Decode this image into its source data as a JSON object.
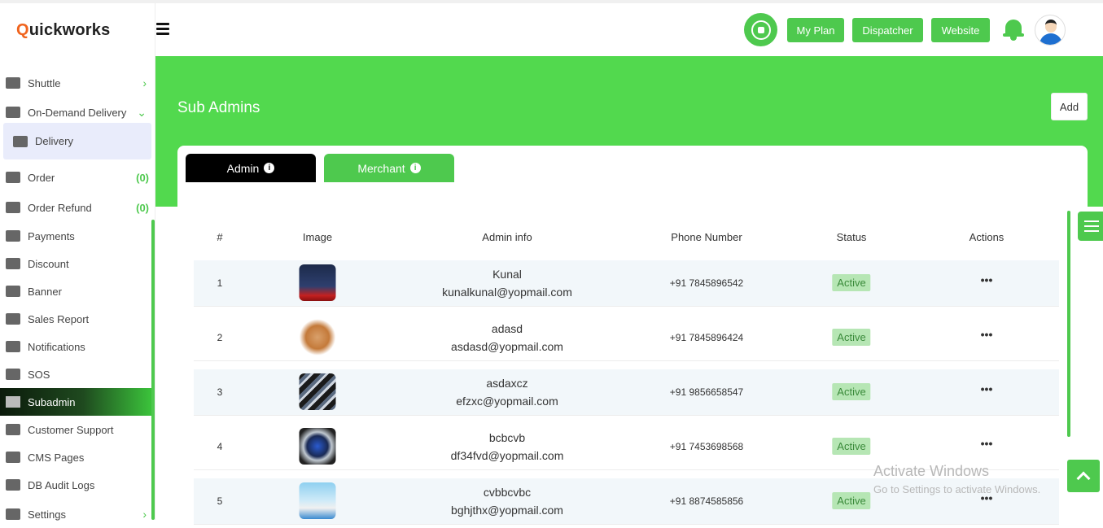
{
  "brand": {
    "q": "Q",
    "rest": "uickworks"
  },
  "sidebar": {
    "items": [
      {
        "label": "Shuttle",
        "icon": "bus-icon",
        "chevron": "›"
      },
      {
        "label": "On-Demand Delivery",
        "icon": "car-icon",
        "chevron": "⌄"
      },
      {
        "label": "Delivery",
        "icon": "car-icon"
      },
      {
        "label": "Order",
        "icon": "bag-icon",
        "count": "(0)"
      },
      {
        "label": "Order Refund",
        "icon": "bag-icon",
        "count": "(0)"
      },
      {
        "label": "Payments",
        "icon": "payments-icon"
      },
      {
        "label": "Discount",
        "icon": "discount-icon"
      },
      {
        "label": "Banner",
        "icon": "image-icon"
      },
      {
        "label": "Sales Report",
        "icon": "chart-icon"
      },
      {
        "label": "Notifications",
        "icon": "bell-icon"
      },
      {
        "label": "SOS",
        "icon": "alarm-icon"
      },
      {
        "label": "Subadmin",
        "icon": "users-icon"
      },
      {
        "label": "Customer Support",
        "icon": "support-icon"
      },
      {
        "label": "CMS Pages",
        "icon": "code-icon"
      },
      {
        "label": "DB Audit Logs",
        "icon": "database-icon"
      },
      {
        "label": "Settings",
        "icon": "gear-icon",
        "chevron": "›"
      }
    ]
  },
  "header": {
    "buttons": {
      "my_plan": "My Plan",
      "dispatcher": "Dispatcher",
      "website": "Website"
    }
  },
  "page": {
    "title": "Sub Admins",
    "add_label": "Add"
  },
  "tabs": {
    "admin": "Admin",
    "merchant": "Merchant",
    "info_glyph": "i"
  },
  "table": {
    "headers": {
      "index": "#",
      "image": "Image",
      "info": "Admin info",
      "phone": "Phone Number",
      "status": "Status",
      "actions": "Actions"
    },
    "rows": [
      {
        "index": "1",
        "name": "Kunal",
        "email": "kunalkunal@yopmail.com",
        "phone": "+91 7845896542",
        "status": "Active",
        "actions": "•••"
      },
      {
        "index": "2",
        "name": "adasd",
        "email": "asdasd@yopmail.com",
        "phone": "+91 7845896424",
        "status": "Active",
        "actions": "•••"
      },
      {
        "index": "3",
        "name": "asdaxcz",
        "email": "efzxc@yopmail.com",
        "phone": "+91 9856658547",
        "status": "Active",
        "actions": "•••"
      },
      {
        "index": "4",
        "name": "bcbcvb",
        "email": "df34fvd@yopmail.com",
        "phone": "+91 7453698568",
        "status": "Active",
        "actions": "•••"
      },
      {
        "index": "5",
        "name": "cvbbcvbc",
        "email": "bghjthx@yopmail.com",
        "phone": "+91 8874585856",
        "status": "Active",
        "actions": "•••"
      }
    ]
  },
  "watermark": {
    "line1": "Activate Windows",
    "line2": "Go to Settings to activate Windows."
  },
  "colors": {
    "accent": "#52d94e",
    "dark_tab": "#000000",
    "status_bg": "#b6e6b4"
  }
}
